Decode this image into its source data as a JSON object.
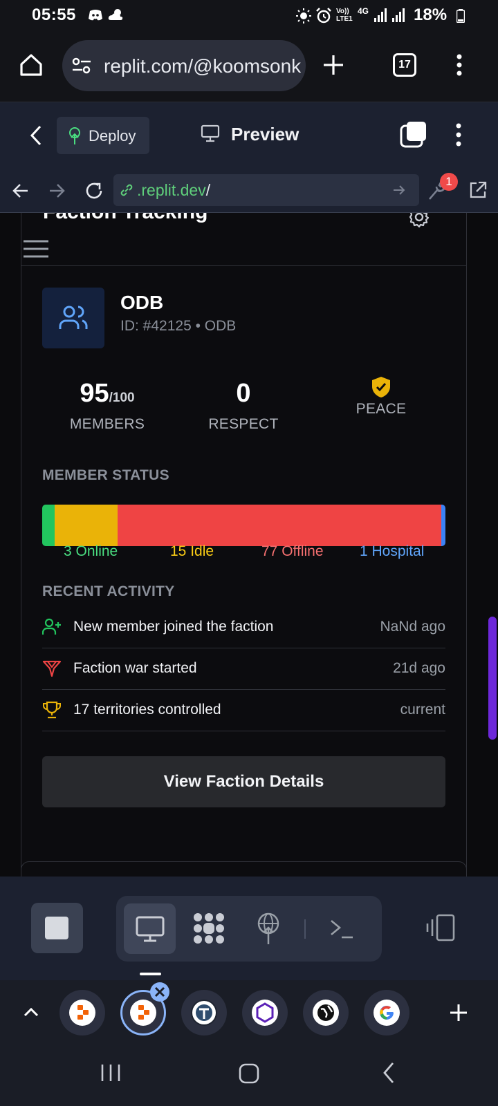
{
  "status_bar": {
    "time": "05:55",
    "network_top": "Vo)) LTE1",
    "network_type": "4G",
    "battery": "18%"
  },
  "browser": {
    "url": "replit.com/@koomsonk",
    "tab_count": "17"
  },
  "replit_header": {
    "deploy_label": "Deploy",
    "preview_label": "Preview"
  },
  "webview": {
    "url_domain": ".replit.dev",
    "url_path": "/",
    "notification_count": "1"
  },
  "card": {
    "title": "Faction Tracking",
    "faction_name": "ODB",
    "faction_id": "ID: #42125 • ODB",
    "members": "95",
    "members_max": "/100",
    "members_label": "MEMBERS",
    "respect": "0",
    "respect_label": "RESPECT",
    "status_label": "PEACE",
    "member_status_heading": "MEMBER STATUS",
    "member_status": [
      {
        "label": "3 Online",
        "count": 3,
        "color": "#22c55e"
      },
      {
        "label": "15 Idle",
        "count": 15,
        "color": "#eab308"
      },
      {
        "label": "77 Offline",
        "count": 77,
        "color": "#ef4444"
      },
      {
        "label": "1 Hospital",
        "count": 1,
        "color": "#3b82f6"
      }
    ],
    "recent_activity_heading": "RECENT ACTIVITY",
    "activities": [
      {
        "text": "New member joined the faction",
        "time": "NaNd ago",
        "icon": "user-plus-icon",
        "color": "#22c55e"
      },
      {
        "text": "Faction war started",
        "time": "21d ago",
        "icon": "swords-icon",
        "color": "#ef4444"
      },
      {
        "text": "17 territories controlled",
        "time": "current",
        "icon": "trophy-icon",
        "color": "#eab308"
      }
    ],
    "view_button": "View Faction Details"
  },
  "colors": {
    "accent_blue": "#3b82f6",
    "scrollbar": "#6d28d9",
    "peace_shield": "#eab308"
  }
}
